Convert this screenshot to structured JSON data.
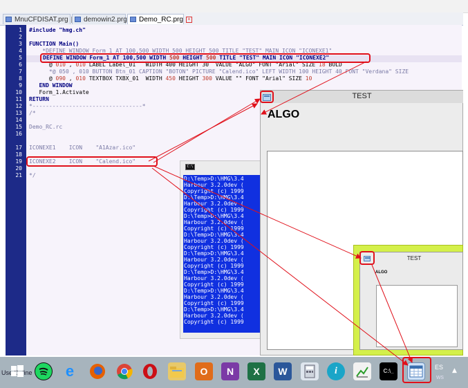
{
  "tabs": [
    {
      "label": "MnuCFDISAT.prg",
      "active": false
    },
    {
      "label": "demowin2.prg",
      "active": false
    },
    {
      "label": "Demo_RC.prg",
      "active": true
    }
  ],
  "editor": {
    "line_numbers": [
      "1",
      "2",
      "3",
      "4",
      "5",
      "6",
      "7",
      "8",
      "9",
      "10",
      "11",
      "12",
      "13",
      "14",
      "15",
      "16",
      "17",
      "18",
      "19",
      "20",
      "21"
    ],
    "lines": {
      "l1": "#include \"hmg.ch\"",
      "l3": "FUNCTION Main()",
      "l4": "    *DEFINE WINDOW Form_1 AT 100,500 WIDTH 500 HEIGHT 500 TITLE \"TEST\" MAIN ICON \"ICONEXE1\"",
      "l5_a": "DEFINE WINDOW Form_1 AT 100,500 WIDTH ",
      "l5_b": "500",
      "l5_c": " HEIGHT ",
      "l5_d": "500",
      "l5_e": " TITLE \"TEST\" MAIN ICON \"ICONEXE2\"",
      "l6_a": "      @ ",
      "l6_b": "010",
      "l6_c": " , ",
      "l6_d": "010",
      "l6_e": " LABEL Label_01   WIDTH 400 HEIGHT 30  VALUE \"ALGO\" FONT \"Arial\" SIZE ",
      "l6_f": "18",
      "l6_g": " BOLD",
      "l7": "      *@ 050 , 010 BUTTON Btn_01 CAPTION \"BOTON\" PICTURE \"Calend.ico\" LEFT WIDTH 100 HEIGHT 40 FONT \"Verdana\" SIZE",
      "l8_a": "      @ ",
      "l8_b": "090",
      "l8_c": " , ",
      "l8_d": "010",
      "l8_e": " TEXTBOX TXBX_01  WIDTH ",
      "l8_f": "450",
      "l8_g": " HEIGHT ",
      "l8_h": "300",
      "l8_i": " VALUE \"\" FONT \"Arial\" SIZE ",
      "l8_j": "10",
      "l9": "   END WINDOW",
      "l10": "   Form_1.Activate",
      "l11": "RETURN",
      "l12": "*---------------------------------*",
      "l13": "/*",
      "l15": "Demo_RC.rc",
      "l17": "ICONEXE1    ICON    \"A1Azar.ico\"",
      "l19": "ICONEXE2    ICON    \"Calend.ico\"",
      "l21": "*/"
    }
  },
  "console": {
    "icon_text": "C:\\",
    "lines": [
      "D:\\Temp>D:\\HMG\\3.4",
      "Harbour 3.2.0dev (",
      "Copyright (c) 1999",
      "D:\\Temp>D:\\HMG\\3.4",
      "Harbour 3.2.0dev (",
      "Copyright (c) 1999",
      "D:\\Temp>D:\\HMG\\3.4",
      "Harbour 3.2.0dev (",
      "Copyright (c) 1999",
      "D:\\Temp>D:\\HMG\\3.4",
      "Harbour 3.2.0dev (",
      "Copyright (c) 1999",
      "D:\\Temp>D:\\HMG\\3.4",
      "Harbour 3.2.0dev (",
      "Copyright (c) 1999",
      "D:\\Temp>D:\\HMG\\3.4",
      "Harbour 3.2.0dev (",
      "Copyright (c) 1999",
      "D:\\Temp>D:\\HMG\\3.4",
      "Harbour 3.2.0dev (",
      "Copyright (c) 1999",
      "D:\\Temp>D:\\HMG\\3.4",
      "Harbour 3.2.0dev (",
      "Copyright (c) 1999"
    ]
  },
  "test_window": {
    "title": "TEST",
    "label": "ALGO"
  },
  "test_window_small": {
    "title": "TEST",
    "label": "ALGO"
  },
  "taskbar": {
    "behind_text": "Use Define",
    "lang": "ES",
    "suffix": "ws"
  },
  "colors": {
    "editor_bg": "#f7f3fb",
    "gutter": "#1d2a88",
    "highlight_box": "#e0101a",
    "console_bg": "#1030e0",
    "small_window_frame": "#d4f04a",
    "taskbar": "#a7b4bd"
  }
}
